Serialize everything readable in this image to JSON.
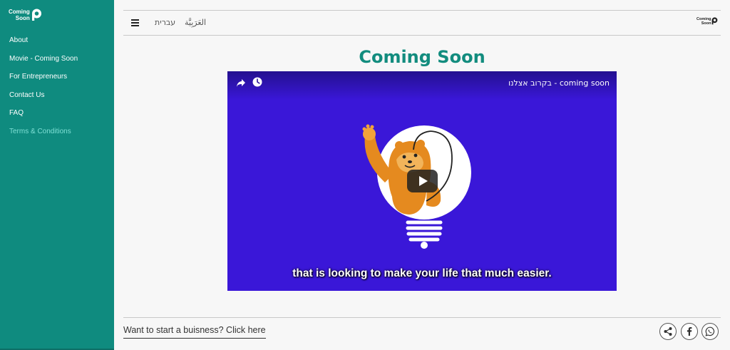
{
  "brand": {
    "logo_text": "Coming Soon"
  },
  "sidebar": {
    "items": [
      {
        "label": "About"
      },
      {
        "label": "Movie - Coming Soon"
      },
      {
        "label": "For Entrepreneurs"
      },
      {
        "label": "Contact Us"
      },
      {
        "label": "FAQ"
      },
      {
        "label": "Terms & Conditions"
      }
    ],
    "active_color": "#7fe0d6",
    "background": "#0f8b7f"
  },
  "header": {
    "languages": [
      {
        "label": "עברית"
      },
      {
        "label": "العَرَبِيَّة"
      }
    ]
  },
  "main": {
    "title": "Coming Soon",
    "title_color": "#128c7e"
  },
  "video": {
    "title": "בקרוב אצלנו - coming soon",
    "subtitle": "that is looking to make your life that much easier.",
    "background": "#3a17d8"
  },
  "footer": {
    "cta_label": "Want to start a buisness? Click here",
    "social": [
      {
        "icon": "share-icon"
      },
      {
        "icon": "facebook-icon"
      },
      {
        "icon": "whatsapp-icon"
      }
    ]
  }
}
